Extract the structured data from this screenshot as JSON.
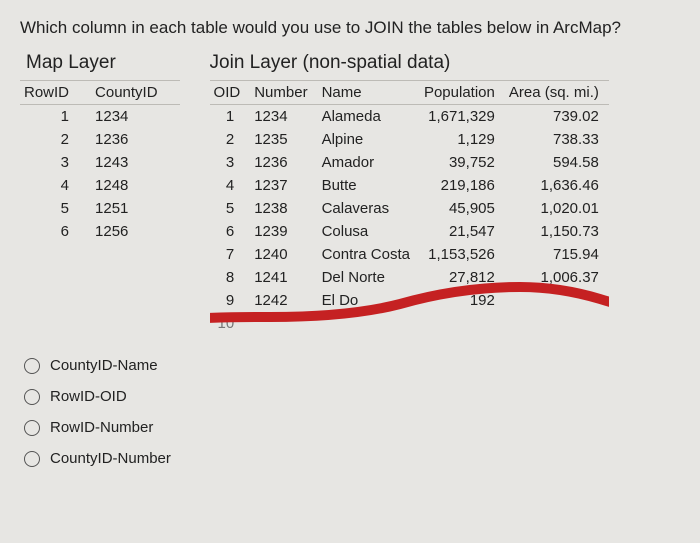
{
  "question": "Which column in each table would you use to JOIN the tables below in ArcMap?",
  "left": {
    "title": "Map Layer",
    "headers": [
      "RowID",
      "CountyID"
    ],
    "rows": [
      {
        "RowID": "1",
        "CountyID": "1234"
      },
      {
        "RowID": "2",
        "CountyID": "1236"
      },
      {
        "RowID": "3",
        "CountyID": "1243"
      },
      {
        "RowID": "4",
        "CountyID": "1248"
      },
      {
        "RowID": "5",
        "CountyID": "1251"
      },
      {
        "RowID": "6",
        "CountyID": "1256"
      }
    ]
  },
  "right": {
    "title": "Join Layer (non-spatial data)",
    "headers": [
      "OID",
      "Number",
      "Name",
      "Population",
      "Area (sq. mi.)"
    ],
    "rows": [
      {
        "OID": "1",
        "Number": "1234",
        "Name": "Alameda",
        "Population": "1,671,329",
        "Area": "739.02"
      },
      {
        "OID": "2",
        "Number": "1235",
        "Name": "Alpine",
        "Population": "1,129",
        "Area": "738.33"
      },
      {
        "OID": "3",
        "Number": "1236",
        "Name": "Amador",
        "Population": "39,752",
        "Area": "594.58"
      },
      {
        "OID": "4",
        "Number": "1237",
        "Name": "Butte",
        "Population": "219,186",
        "Area": "1,636.46"
      },
      {
        "OID": "5",
        "Number": "1238",
        "Name": "Calaveras",
        "Population": "45,905",
        "Area": "1,020.01"
      },
      {
        "OID": "6",
        "Number": "1239",
        "Name": "Colusa",
        "Population": "21,547",
        "Area": "1,150.73"
      },
      {
        "OID": "7",
        "Number": "1240",
        "Name": "Contra Costa",
        "Population": "1,153,526",
        "Area": "715.94"
      },
      {
        "OID": "8",
        "Number": "1241",
        "Name": "Del Norte",
        "Population": "27,812",
        "Area": "1,006.37"
      },
      {
        "OID": "9",
        "Number": "1242",
        "Name": "El Do",
        "Population": "192",
        "Area": ""
      },
      {
        "OID": "10",
        "Number": "",
        "Name": "",
        "Population": "",
        "Area": ""
      }
    ]
  },
  "options": [
    {
      "label": "CountyID-Name"
    },
    {
      "label": "RowID-OID"
    },
    {
      "label": "RowID-Number"
    },
    {
      "label": "CountyID-Number"
    }
  ]
}
